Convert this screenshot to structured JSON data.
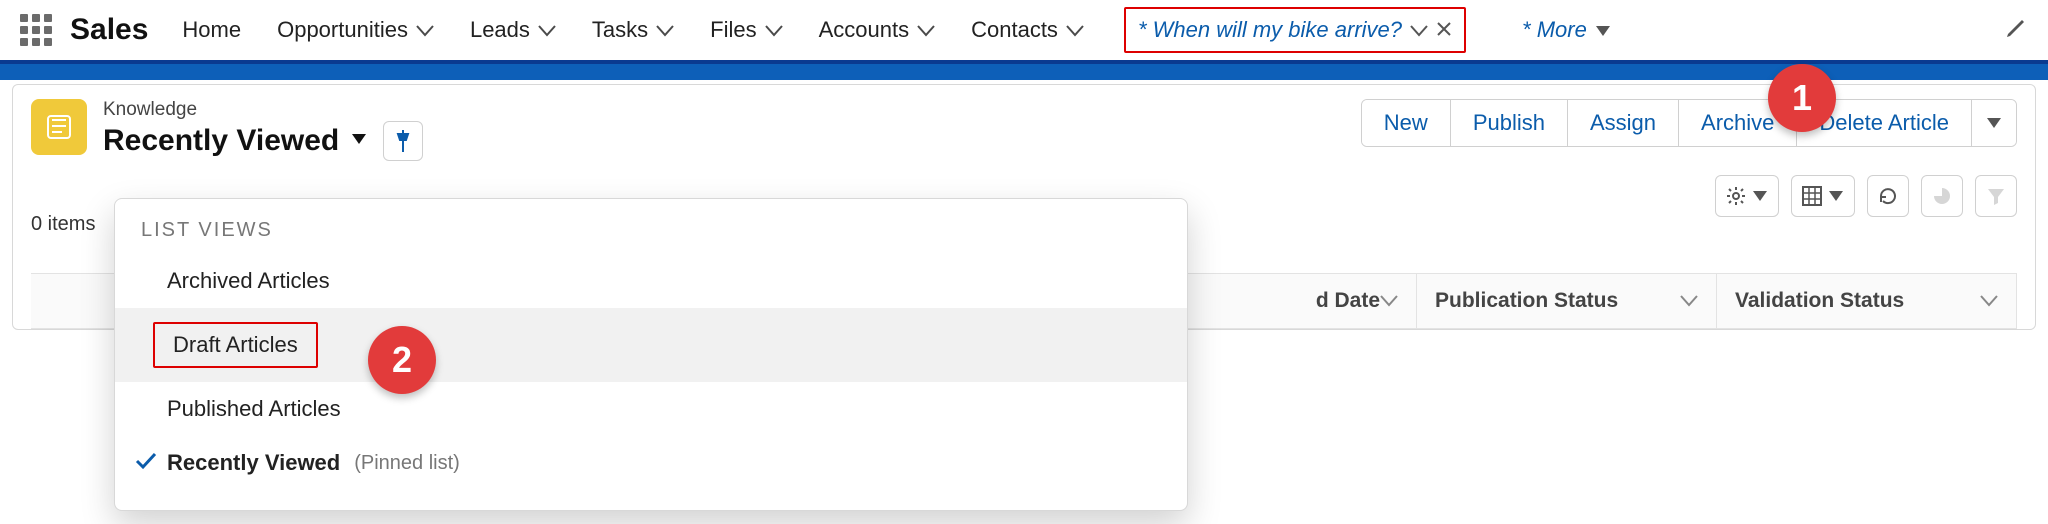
{
  "nav": {
    "app_name": "Sales",
    "items": [
      "Home",
      "Opportunities",
      "Leads",
      "Tasks",
      "Files",
      "Accounts",
      "Contacts"
    ],
    "active_tab": "* When will my bike arrive?",
    "more_label": "* More"
  },
  "page": {
    "object_label": "Knowledge",
    "list_view_title": "Recently Viewed",
    "items_count_text": "0 items"
  },
  "actions": {
    "buttons": [
      "New",
      "Publish",
      "Assign",
      "Archive",
      "Delete Article"
    ]
  },
  "list_views_dropdown": {
    "heading": "LIST VIEWS",
    "items": [
      {
        "label": "Archived Articles"
      },
      {
        "label": "Draft Articles",
        "boxed": true,
        "selected_row": true
      },
      {
        "label": "Published Articles"
      },
      {
        "label": "Recently Viewed",
        "checked": true,
        "suffix": "(Pinned list)"
      }
    ]
  },
  "table_headers": {
    "col_partial": "d Date",
    "col1": "Publication Status",
    "col2": "Validation Status"
  },
  "callouts": {
    "b1": "1",
    "b2": "2"
  }
}
